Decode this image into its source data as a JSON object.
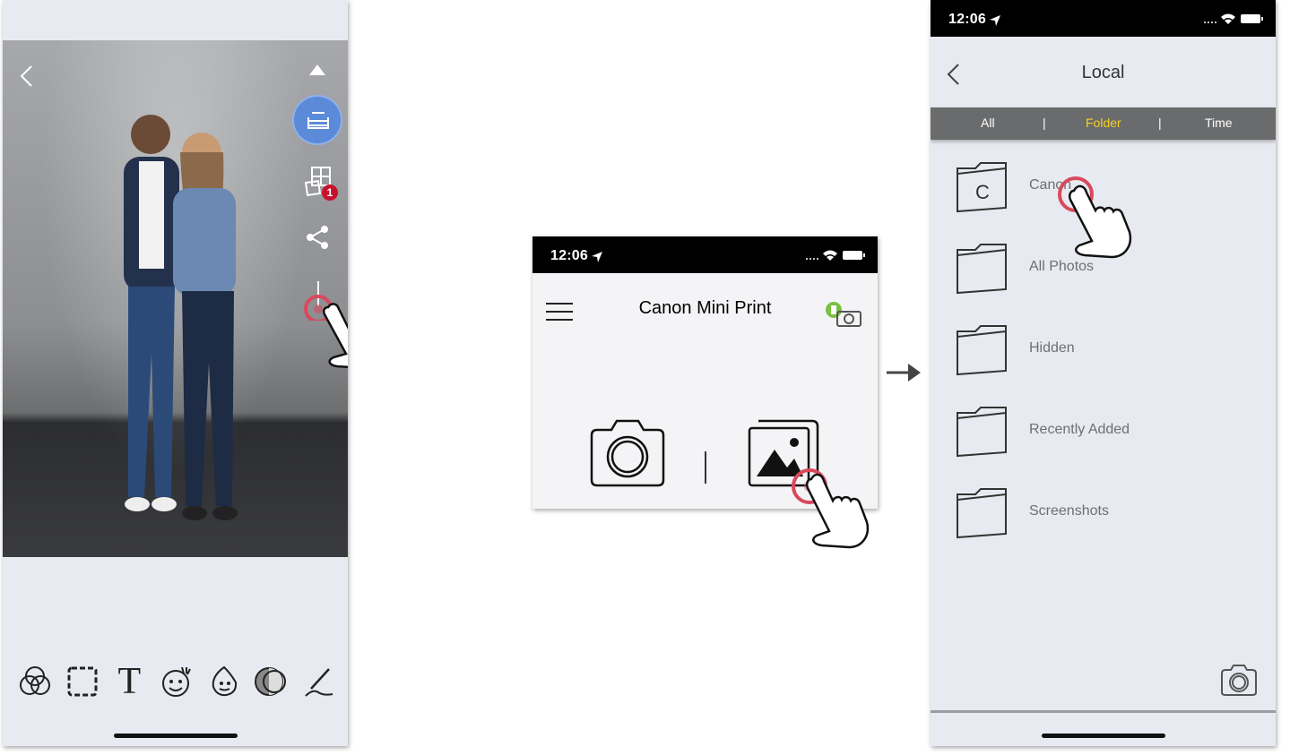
{
  "left_panel": {
    "icons": {
      "back": "chevron-left-icon",
      "collapse": "chevron-up-icon",
      "print": "printer-icon",
      "collage": "collage-icon",
      "share": "share-icon",
      "download": "download-icon"
    },
    "collage_badge": "1",
    "tools": [
      "filter-icon",
      "frame-icon",
      "text-icon",
      "sticker-icon",
      "face-icon",
      "brightness-icon",
      "draw-icon"
    ],
    "tool_text_glyph": "T"
  },
  "middle_panel": {
    "status_time": "12:06",
    "title": "Canon Mini Print",
    "icons": {
      "menu": "hamburger-icon",
      "printer_status": "printer-status-icon",
      "camera": "camera-icon",
      "gallery": "gallery-icon"
    }
  },
  "right_panel": {
    "status_time": "12:06",
    "title": "Local",
    "tabs": [
      {
        "label": "All",
        "active": false
      },
      {
        "label": "Folder",
        "active": true
      },
      {
        "label": "Time",
        "active": false
      }
    ],
    "tab_separator": "|",
    "folders": [
      {
        "label": "Canon",
        "letter": "C"
      },
      {
        "label": "All Photos",
        "letter": ""
      },
      {
        "label": "Hidden",
        "letter": ""
      },
      {
        "label": "Recently Added",
        "letter": ""
      },
      {
        "label": "Screenshots",
        "letter": ""
      }
    ]
  },
  "colors": {
    "accent_blue": "#5b8ad9",
    "badge_red": "#c8102e",
    "tab_active": "#f5d328",
    "tab_bar": "#6a6b6d",
    "tap_ring": "#d9495b",
    "status_green": "#7ac142"
  }
}
